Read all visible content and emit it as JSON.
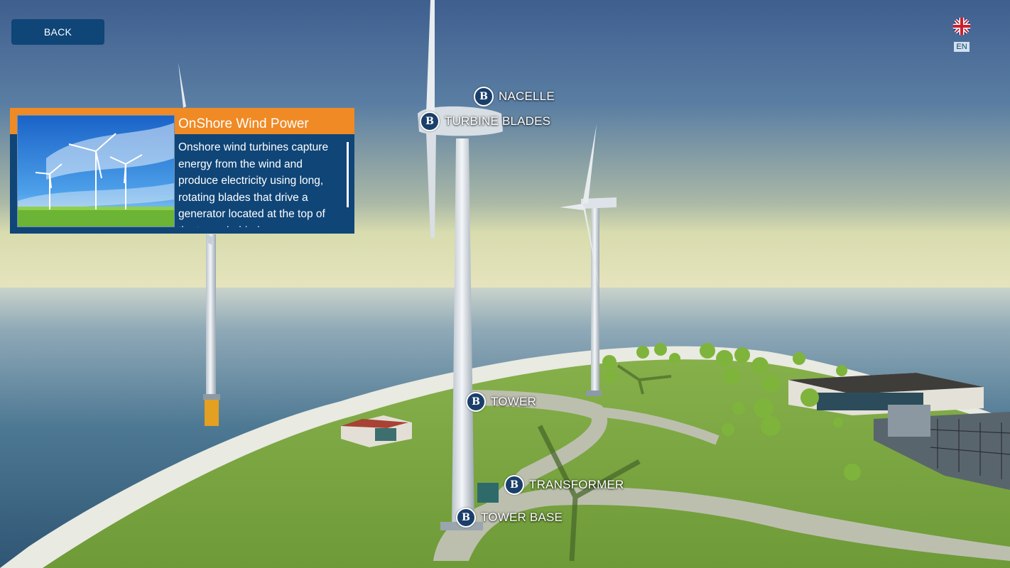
{
  "nav": {
    "back_label": "BACK"
  },
  "language": {
    "code": "EN",
    "flag_icon": "uk-flag-icon"
  },
  "info_panel": {
    "title": "OnShore Wind Power",
    "body": "Onshore wind turbines capture energy from the wind and produce electricity using long, rotating blades that drive a generator located at the top of the tower behind",
    "image_icon": "wind-turbines-photo"
  },
  "hotspots": {
    "nacelle": {
      "badge": "B",
      "label": "NACELLE"
    },
    "turbine_blades": {
      "badge": "B",
      "label": "TURBINE BLADES"
    },
    "tower": {
      "badge": "B",
      "label": "TOWER"
    },
    "transformer": {
      "badge": "B",
      "label": "TRANSFORMER"
    },
    "tower_base": {
      "badge": "B",
      "label": "TOWER BASE"
    }
  },
  "colors": {
    "accent_orange": "#f08a24",
    "primary_navy": "#0f4577",
    "badge_navy": "#1b3f6b"
  }
}
